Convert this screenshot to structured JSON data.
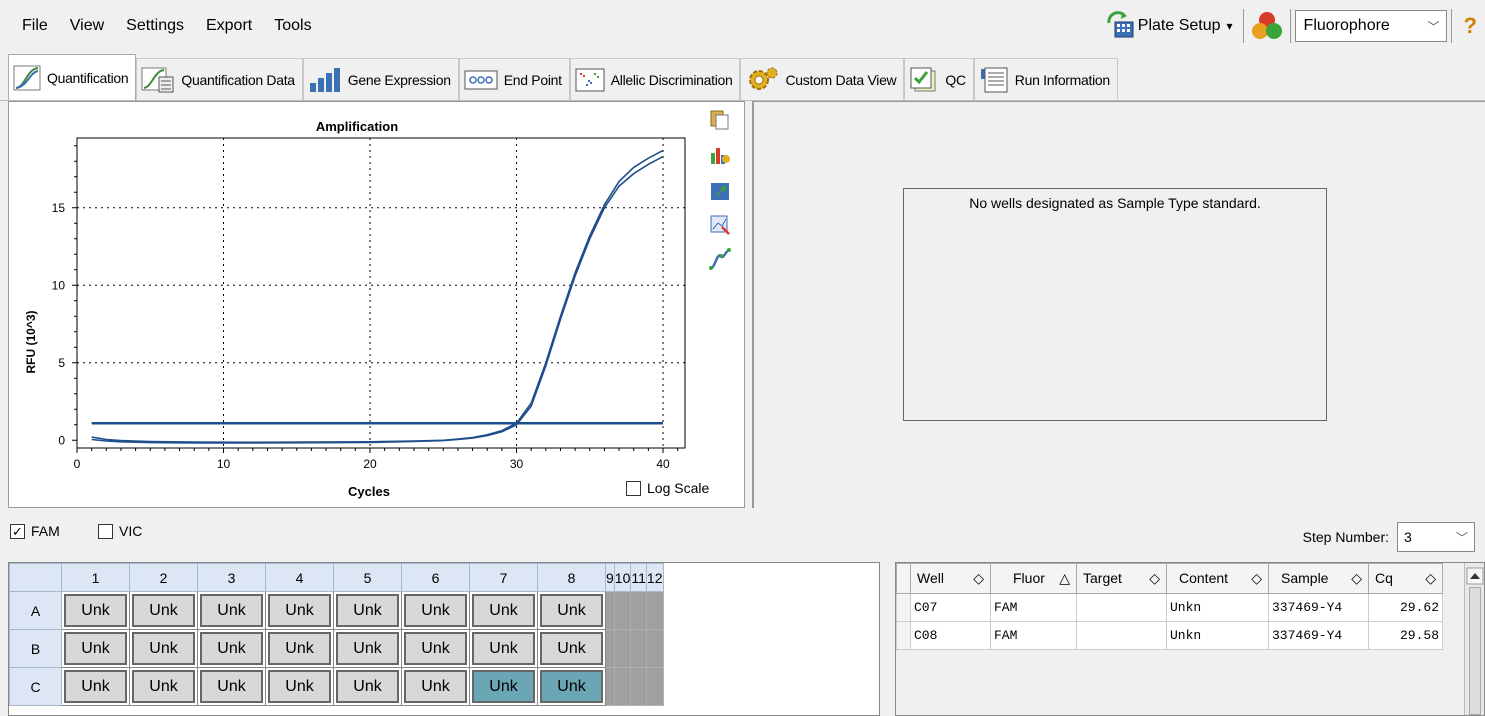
{
  "menu": [
    "File",
    "View",
    "Settings",
    "Export",
    "Tools"
  ],
  "toolbar": {
    "plate_setup": "Plate Setup",
    "plate_arrow": "▾",
    "fluor_select": "Fluorophore",
    "help": "?"
  },
  "tabs": [
    {
      "label": "Quantification",
      "icon": "amplification-curve-icon"
    },
    {
      "label": "Quantification Data",
      "icon": "quant-data-icon"
    },
    {
      "label": "Gene Expression",
      "icon": "bar-chart-icon"
    },
    {
      "label": "End Point",
      "icon": "end-point-icon"
    },
    {
      "label": "Allelic Discrimination",
      "icon": "scatter-plot-icon"
    },
    {
      "label": "Custom Data View",
      "icon": "gear-icon"
    },
    {
      "label": "QC",
      "icon": "checklist-icon"
    },
    {
      "label": "Run Information",
      "icon": "document-icon"
    }
  ],
  "chart_data": {
    "type": "line",
    "title": "Amplification",
    "xlabel": "Cycles",
    "ylabel": "RFU (10^3)",
    "xlim": [
      0,
      41.5
    ],
    "ylim": [
      -0.5,
      19.5
    ],
    "xticks": [
      0,
      10,
      20,
      30,
      40
    ],
    "yticks": [
      0,
      5,
      10,
      15
    ],
    "grid": "dotted",
    "threshold": 1.1,
    "series": [
      {
        "x": [
          1,
          2,
          3,
          5,
          8,
          12,
          16,
          20,
          23,
          25,
          26,
          27,
          28,
          29,
          30,
          31,
          32,
          33,
          34,
          35,
          36,
          37,
          38,
          39,
          40
        ],
        "values": [
          0.2,
          0.05,
          -0.02,
          -0.08,
          -0.12,
          -0.13,
          -0.12,
          -0.1,
          -0.05,
          0.0,
          0.08,
          0.18,
          0.35,
          0.62,
          1.1,
          2.4,
          5.0,
          8.0,
          10.8,
          13.2,
          15.2,
          16.7,
          17.6,
          18.2,
          18.7
        ]
      },
      {
        "x": [
          1,
          2,
          3,
          5,
          8,
          12,
          16,
          20,
          23,
          25,
          26,
          27,
          28,
          29,
          30,
          31,
          32,
          33,
          34,
          35,
          36,
          37,
          38,
          39,
          40
        ],
        "values": [
          0.05,
          -0.05,
          -0.1,
          -0.15,
          -0.17,
          -0.17,
          -0.16,
          -0.14,
          -0.08,
          -0.02,
          0.05,
          0.14,
          0.3,
          0.55,
          1.0,
          2.2,
          4.8,
          7.8,
          10.6,
          13.0,
          15.0,
          16.4,
          17.2,
          17.8,
          18.3
        ]
      }
    ]
  },
  "log_scale_label": "Log Scale",
  "no_wells_message": "No wells designated as Sample Type standard.",
  "filters": {
    "fam": "FAM",
    "vic": "VIC",
    "fam_check": "✓",
    "step_label": "Step Number:",
    "step_value": "3",
    "step_arrow": "﹀"
  },
  "plate": {
    "columns": [
      "1",
      "2",
      "3",
      "4",
      "5",
      "6",
      "7",
      "8",
      "9",
      "10",
      "11",
      "12"
    ],
    "rows": [
      {
        "label": "A",
        "wells": [
          "Unk",
          "Unk",
          "Unk",
          "Unk",
          "Unk",
          "Unk",
          "Unk",
          "Unk"
        ]
      },
      {
        "label": "B",
        "wells": [
          "Unk",
          "Unk",
          "Unk",
          "Unk",
          "Unk",
          "Unk",
          "Unk",
          "Unk"
        ]
      },
      {
        "label": "C",
        "wells": [
          "Unk",
          "Unk",
          "Unk",
          "Unk",
          "Unk",
          "Unk",
          "Unk",
          "Unk"
        ]
      }
    ]
  },
  "results": {
    "headers": [
      "Well",
      "Fluor",
      "Target",
      "Content",
      "Sample",
      "Cq"
    ],
    "header_sort": [
      "◇",
      "△",
      "◇",
      "◇",
      "◇",
      "◇"
    ],
    "rows": [
      [
        "C07",
        "FAM",
        "",
        "Unkn",
        "337469-Y4",
        "29.62"
      ],
      [
        "C08",
        "FAM",
        "",
        "Unkn",
        "337469-Y4",
        "29.58"
      ]
    ]
  },
  "colors": {
    "curve": "#1f4e8c",
    "threshold": "#1f4e8c",
    "selected_well": "#6aa6b4"
  }
}
